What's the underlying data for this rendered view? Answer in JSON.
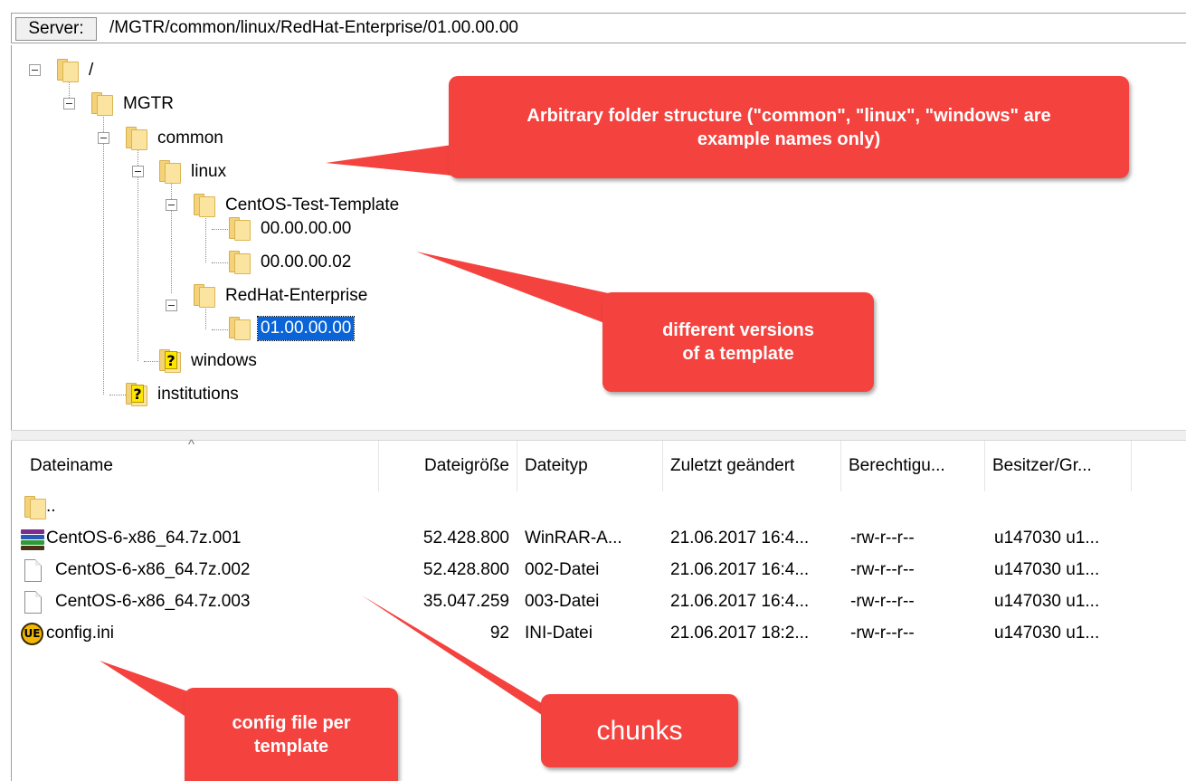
{
  "server_bar": {
    "label": "Server:",
    "path": "/MGTR/common/linux/RedHat-Enterprise/01.00.00.00"
  },
  "tree": {
    "nodes": [
      {
        "label": "/",
        "icon": "folder-icon"
      },
      {
        "label": "MGTR",
        "icon": "folder-icon"
      },
      {
        "label": "common",
        "icon": "folder-icon"
      },
      {
        "label": "linux",
        "icon": "folder-icon"
      },
      {
        "label": "CentOS-Test-Template",
        "icon": "folder-icon"
      },
      {
        "label": "00.00.00.00",
        "icon": "folder-icon"
      },
      {
        "label": "00.00.00.02",
        "icon": "folder-icon"
      },
      {
        "label": "RedHat-Enterprise",
        "icon": "folder-icon"
      },
      {
        "label": "01.00.00.00",
        "icon": "folder-icon",
        "selected": true
      },
      {
        "label": "windows",
        "icon": "unknown-folder-icon"
      },
      {
        "label": "institutions",
        "icon": "unknown-folder-icon"
      }
    ]
  },
  "file_list": {
    "columns": [
      "Dateiname",
      "Dateigröße",
      "Dateityp",
      "Zuletzt geändert",
      "Berechtigu...",
      "Besitzer/Gr..."
    ],
    "sort_indicator": "^",
    "rows": [
      {
        "name": "..",
        "size": "",
        "type": "",
        "modified": "",
        "permissions": "",
        "owner": "",
        "icon": "folder-icon"
      },
      {
        "name": "CentOS-6-x86_64.7z.001",
        "size": "52.428.800",
        "type": "WinRAR-A...",
        "modified": "21.06.2017 16:4...",
        "permissions": "-rw-r--r--",
        "owner": "u147030 u1...",
        "icon": "winrar-archive-icon"
      },
      {
        "name": "CentOS-6-x86_64.7z.002",
        "size": "52.428.800",
        "type": "002-Datei",
        "modified": "21.06.2017 16:4...",
        "permissions": "-rw-r--r--",
        "owner": "u147030 u1...",
        "icon": "blank-file-icon"
      },
      {
        "name": "CentOS-6-x86_64.7z.003",
        "size": "35.047.259",
        "type": "003-Datei",
        "modified": "21.06.2017 16:4...",
        "permissions": "-rw-r--r--",
        "owner": "u147030 u1...",
        "icon": "blank-file-icon"
      },
      {
        "name": "config.ini",
        "size": "92",
        "type": "INI-Datei",
        "modified": "21.06.2017 18:2...",
        "permissions": "-rw-r--r--",
        "owner": "u147030 u1...",
        "icon": "ultraedit-file-icon"
      }
    ]
  },
  "callouts": {
    "folder_structure": "Arbitrary folder structure (\"common\", \"linux\", \"windows\" are example names only)",
    "versions": "different versions of a template",
    "config": "config file per template",
    "chunks": "chunks"
  },
  "colors": {
    "callout": "#f4433f",
    "selection": "#0a64d8",
    "folder": "#fbe3a0"
  }
}
